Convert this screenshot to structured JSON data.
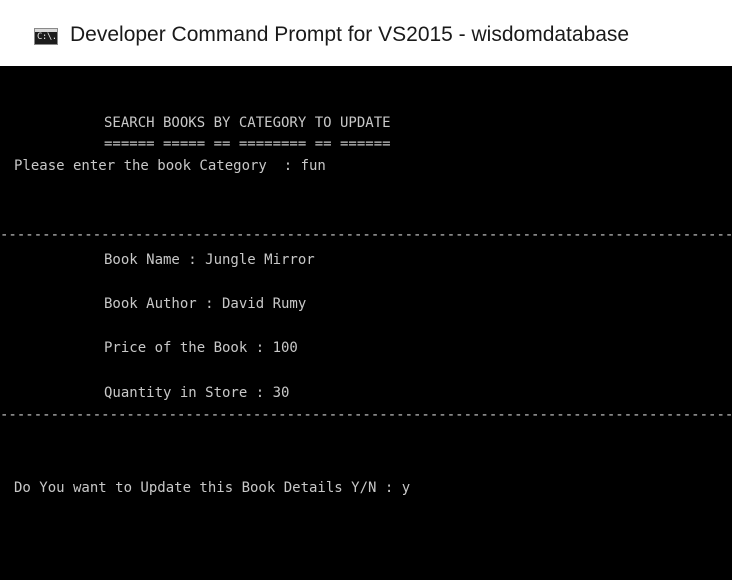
{
  "window": {
    "title": "Developer Command Prompt for VS2015 - wisdomdatabase",
    "icon": "cmd-console-icon",
    "icon_text": "C:\\."
  },
  "console": {
    "heading": "SEARCH BOOKS BY CATEGORY TO UPDATE",
    "heading_underline": "====== ===== == ======== == ======",
    "category_prompt": "Please enter the book Category  : fun",
    "separator": "----------------------------------------------------------------------------------------",
    "book_name": "Book Name : Jungle Mirror",
    "book_author": "Book Author : David Rumy",
    "book_price": "Price of the Book : 100",
    "book_quantity": "Quantity in Store : 30",
    "update_prompt": "Do You want to Update this Book Details Y/N : y"
  },
  "colors": {
    "console_bg": "#000000",
    "console_text": "#c8c8c8",
    "titlebar_bg": "#ffffff"
  }
}
